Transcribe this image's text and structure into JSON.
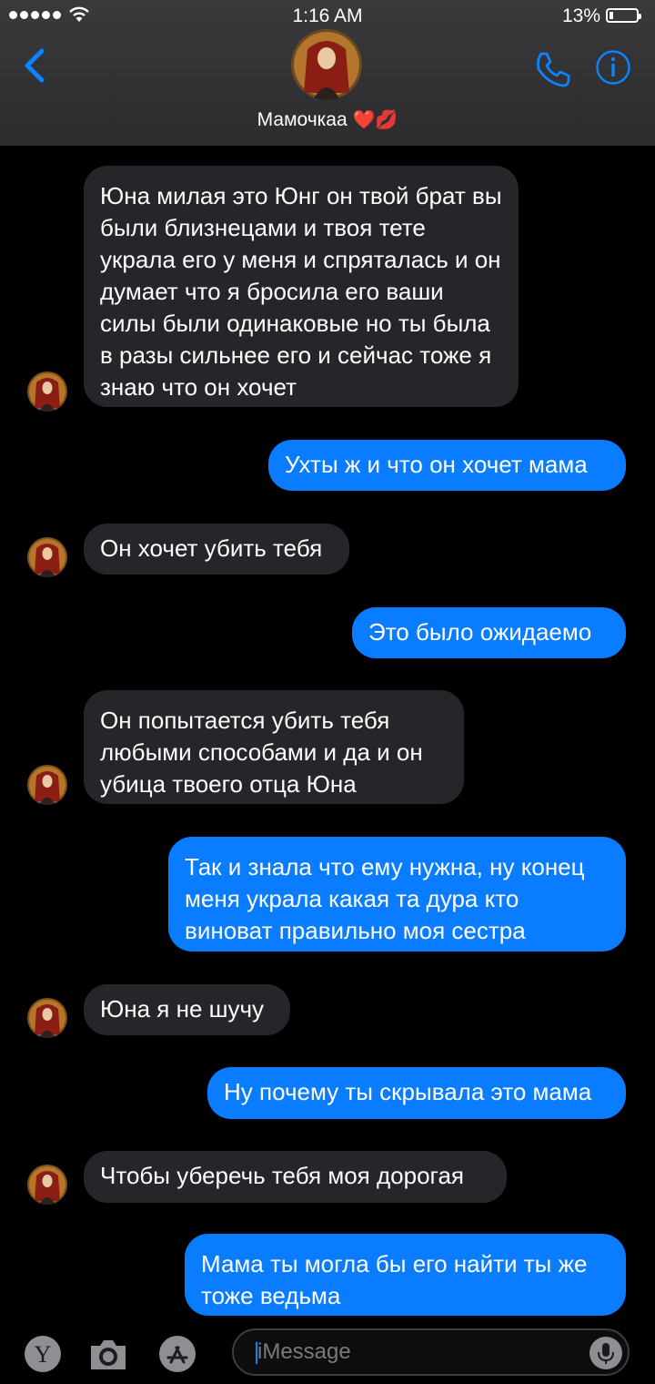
{
  "status": {
    "time": "1:16 AM",
    "battery": "13%"
  },
  "contact": {
    "name": "Мамочкаа",
    "emoji": "❤️💋"
  },
  "messages": [
    {
      "dir": "in",
      "text": "Юна милая это Юнг он твой брат вы были близнецами и твоя тете украла его у меня и спряталась и он думает что я бросила его ваши силы были одинаковые но ты была в разы сильнее его и сейчас тоже я знаю что он хочет"
    },
    {
      "dir": "out",
      "text": "Ухты ж и что он хочет мама"
    },
    {
      "dir": "in",
      "text": "Он хочет убить тебя"
    },
    {
      "dir": "out",
      "text": "Это было ожидаемо"
    },
    {
      "dir": "in",
      "text": "Он попытается убить тебя любыми способами и да и он убица твоего отца Юна"
    },
    {
      "dir": "out",
      "text": "Так и знала что ему нужна, ну конец меня украла какая та дура кто виноват правильно моя сестра"
    },
    {
      "dir": "in",
      "text": "Юна я не шучу"
    },
    {
      "dir": "out",
      "text": "Ну почему ты скрывала это мама"
    },
    {
      "dir": "in",
      "text": "Чтобы уберечь тебя моя дорогая"
    },
    {
      "dir": "out",
      "text": "Мама ты могла бы его найти ты же тоже ведьма"
    }
  ],
  "input": {
    "placeholder": "iMessage"
  },
  "icons": {
    "back": "chevron-left-icon",
    "call": "phone-icon",
    "info": "info-icon",
    "apps": [
      "yahoo-app-icon",
      "camera-icon",
      "app-store-icon"
    ],
    "mic": "microphone-icon"
  },
  "colors": {
    "accent": "#0a84ff",
    "sent_bubble": "#0a7cff",
    "received_bubble": "#26252a"
  }
}
